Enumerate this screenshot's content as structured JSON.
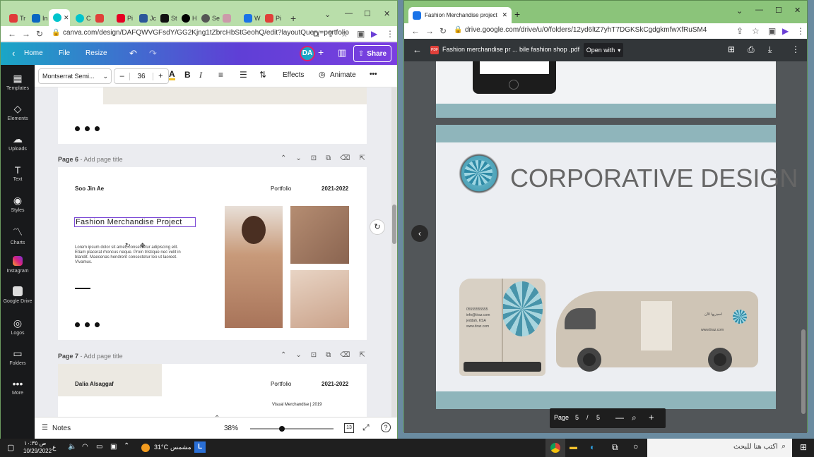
{
  "left_window": {
    "tabs": [
      "Tr",
      "In",
      "",
      "C",
      "Pi",
      "Jc",
      "St",
      "H",
      "Se",
      "",
      "W",
      "Pi"
    ],
    "address_url": "canva.com/design/DAFQWVGFsdY/GG2Kjng1tZbrcHbStGeohQ/edit?layoutQuery=portfolio",
    "topbar": {
      "home": "Home",
      "file": "File",
      "resize": "Resize",
      "avatar": "DA",
      "share": "Share"
    },
    "toolbar": {
      "font": "Montserrat Semi...",
      "minus": "–",
      "size": "36",
      "plus": "+",
      "effects": "Effects",
      "animate": "Animate",
      "more": "•••"
    },
    "sidebar": [
      "Templates",
      "Elements",
      "Uploads",
      "Text",
      "Styles",
      "Charts",
      "Instagram",
      "Google Drive",
      "Logos",
      "Folders",
      "More"
    ],
    "page6": {
      "label": "Page 6",
      "add_title": "- Add page title",
      "name": "Soo Jin Ae",
      "portfolio": "Portfolio",
      "years": "2021-2022",
      "title": "Fashion Merchandise Project",
      "body": "Lorem ipsum dolor sit amet, consectetur adipiscing elit. Etiam placerat rhoncus neque. Proin tristique nec velit in blandit. Maecenas hendrerit consectetur leo ut laoreet. Vivamus."
    },
    "page7": {
      "label": "Page 7",
      "add_title": "- Add page title",
      "name": "Dalia Alsaggaf",
      "portfolio": "Portfolio",
      "years": "2021-2022",
      "sub": "Visual Merchandise | 2019"
    },
    "bottom": {
      "notes": "Notes",
      "zoom": "38%",
      "pages": "13",
      "zoom_level": 0.38
    }
  },
  "right_window": {
    "tab_title": "Fashion Merchandise project - G",
    "address_url": "drive.google.com/drive/u/0/folders/12yd6ltZ7yhT7DGKSkCgdgkmfwXfRuSM4",
    "pdf_title": "Fashion merchandise pr ... bile fashion shop .pdf",
    "open_with": "Open with",
    "slide_heading": "CORPORATIVE DESIGN",
    "van_text": [
      "05555555555",
      "info@tiraz.com",
      "jeddah, KSA",
      "www.tiraz.com"
    ],
    "van_side_text": [
      "احجزيها الآن",
      "www.tiraz.com"
    ],
    "page_label": "Page",
    "page_current": "5",
    "page_sep": "/",
    "page_total": "5"
  },
  "taskbar": {
    "temp": "31°C",
    "weather": "مشمس",
    "time": "ص ١٠:٣٥",
    "date": "10/29/2022",
    "search_placeholder": "اكتب هنا للبحث",
    "lang": "ع"
  },
  "colors": {
    "canva_grad_start": "#1aa6c6",
    "canva_grad_end": "#7b3fe0",
    "pdf_bar": "#323639",
    "slide_bg": "#8fb5bb"
  }
}
